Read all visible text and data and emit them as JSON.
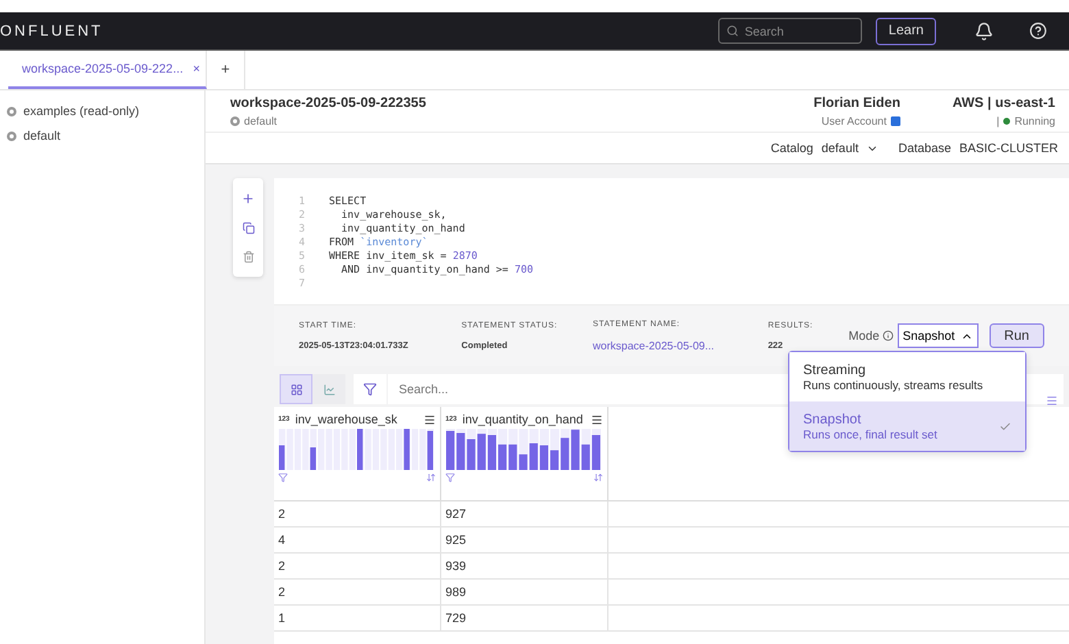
{
  "app": {
    "logo": "ONFLUENT",
    "search_placeholder": "Search",
    "learn": "Learn"
  },
  "tabs": [
    {
      "label": "workspace-2025-05-09-222...",
      "close": "×",
      "selected": true
    }
  ],
  "new_tab": "+",
  "sidebar": {
    "items": [
      {
        "label": "examples (read-only)"
      },
      {
        "label": "default"
      }
    ]
  },
  "workspace": {
    "title": "workspace-2025-05-09-222355",
    "database": "default",
    "user": "Florian Eiden",
    "account": "User Account",
    "region": "AWS | us-east-1",
    "status_separator": "|",
    "status": "Running"
  },
  "catalog": {
    "label": "Catalog",
    "value": "default",
    "database_label": "Database",
    "database": "BASIC-CLUSTER"
  },
  "cell": {
    "code": [
      {
        "no": "1",
        "tokens": [
          {
            "t": "SELECT",
            "kind": "plain"
          }
        ]
      },
      {
        "no": "2",
        "tokens": [
          {
            "t": "  inv_warehouse_sk,",
            "kind": "plain"
          }
        ]
      },
      {
        "no": "3",
        "tokens": [
          {
            "t": "  inv_quantity_on_hand",
            "kind": "plain"
          }
        ]
      },
      {
        "no": "4",
        "tokens": [
          {
            "t": "FROM ",
            "kind": "plain"
          },
          {
            "t": "`inventory`",
            "kind": "string"
          }
        ]
      },
      {
        "no": "5",
        "tokens": [
          {
            "t": "WHERE inv_item_sk = ",
            "kind": "plain"
          },
          {
            "t": "2870",
            "kind": "number"
          }
        ]
      },
      {
        "no": "6",
        "tokens": [
          {
            "t": "  AND inv_quantity_on_hand >= ",
            "kind": "plain"
          },
          {
            "t": "700",
            "kind": "number"
          }
        ]
      },
      {
        "no": "7"
      }
    ],
    "meta": [
      {
        "label": "START TIME:",
        "value": "2025-05-13T23:04:01.733Z",
        "kind": "text"
      },
      {
        "label": "STATEMENT STATUS:",
        "value": "Completed",
        "kind": "text"
      },
      {
        "label": "STATEMENT NAME:",
        "value": "workspace-2025-05-09...",
        "kind": "link"
      },
      {
        "label": "RESULTS:",
        "value": "222",
        "kind": "text"
      }
    ],
    "mode_label": "Mode",
    "mode": "Snapshot",
    "run": "Run",
    "mode_options": [
      {
        "title": "Streaming",
        "description": "Runs continuously, streams results",
        "selected": false
      },
      {
        "title": "Snapshot",
        "description": "Runs once, final result set",
        "selected": true
      }
    ],
    "view_tabs": [
      {
        "kind": "table",
        "selected": true
      },
      {
        "kind": "chart",
        "selected": false
      }
    ],
    "search_placeholder": "Search...",
    "columns": [
      {
        "type": "123",
        "name": "inv_warehouse_sk"
      },
      {
        "type": "123",
        "name": "inv_quantity_on_hand"
      }
    ],
    "rows": [
      [
        "2",
        "927"
      ],
      [
        "4",
        "925"
      ],
      [
        "2",
        "939"
      ],
      [
        "2",
        "989"
      ],
      [
        "1",
        "729"
      ]
    ]
  }
}
